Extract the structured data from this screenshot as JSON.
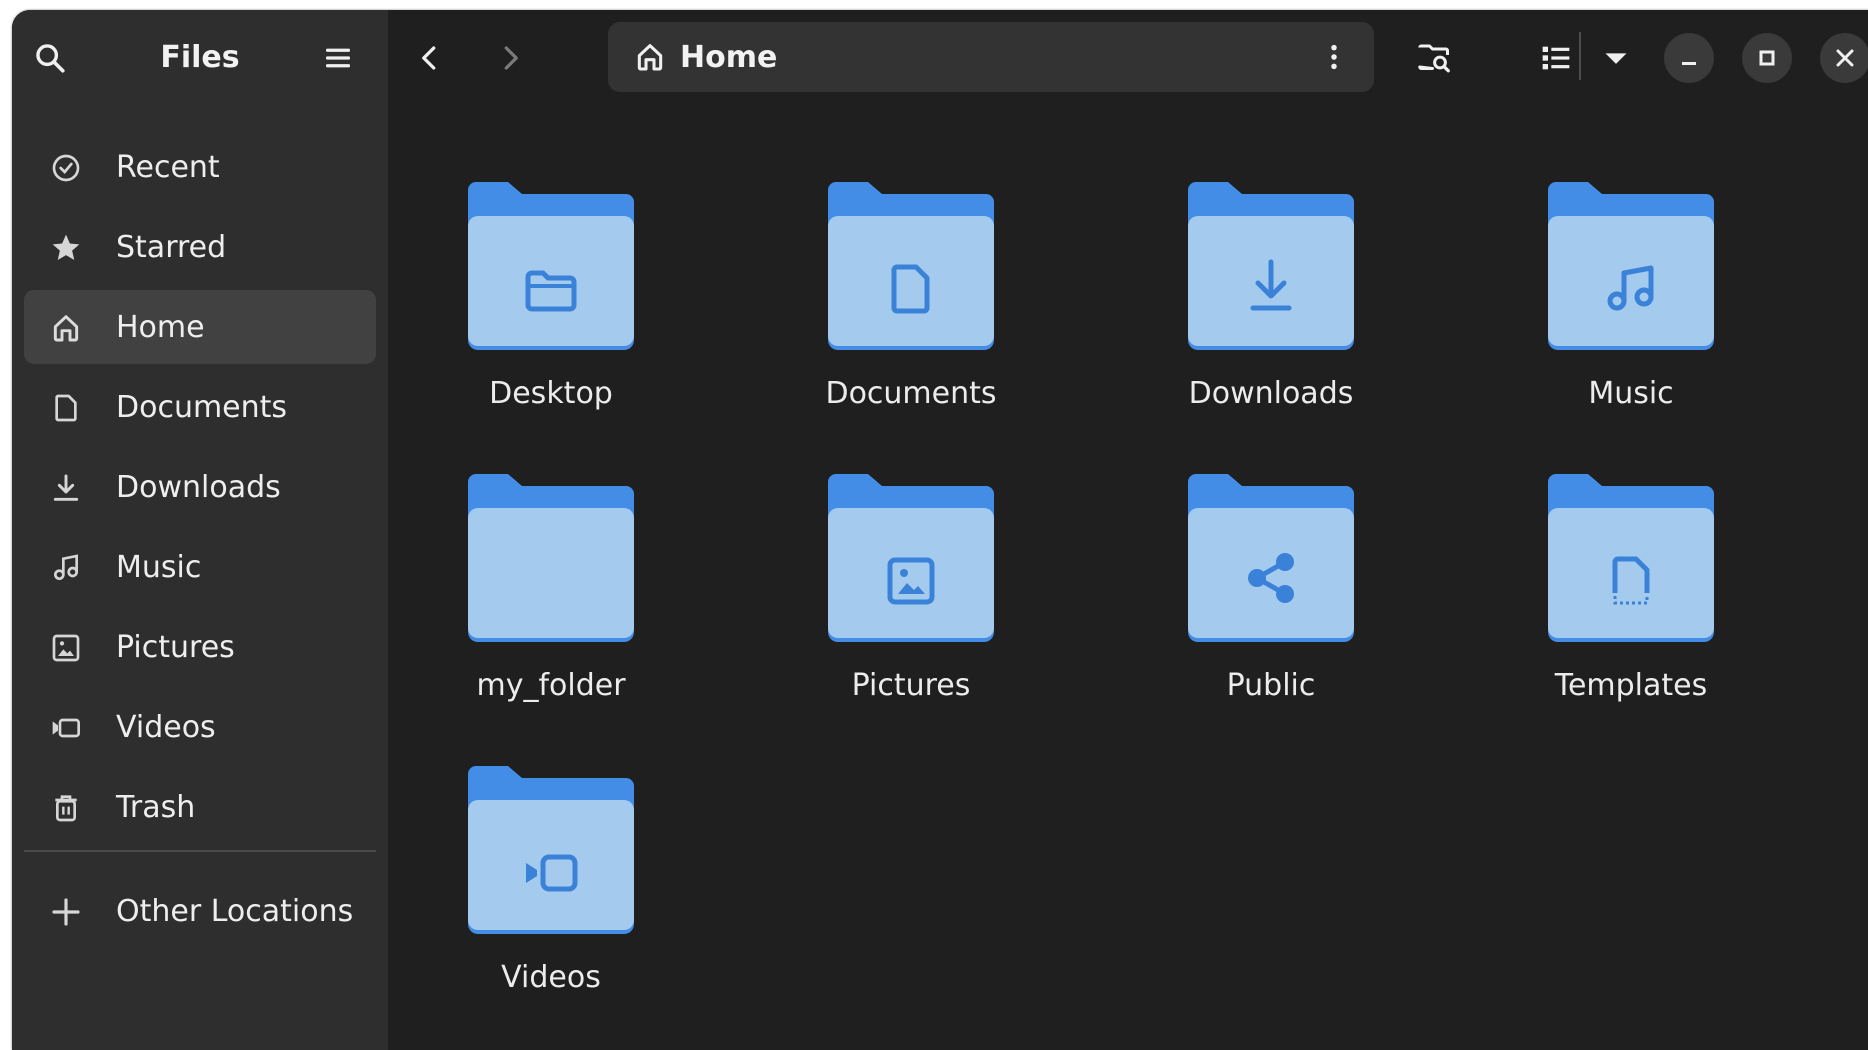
{
  "app": {
    "title": "Files"
  },
  "sidebar": {
    "items": [
      {
        "label": "Recent",
        "icon": "clock-icon",
        "active": false
      },
      {
        "label": "Starred",
        "icon": "star-icon",
        "active": false
      },
      {
        "label": "Home",
        "icon": "home-icon",
        "active": true
      },
      {
        "label": "Documents",
        "icon": "document-icon",
        "active": false
      },
      {
        "label": "Downloads",
        "icon": "download-icon",
        "active": false
      },
      {
        "label": "Music",
        "icon": "music-icon",
        "active": false
      },
      {
        "label": "Pictures",
        "icon": "picture-icon",
        "active": false
      },
      {
        "label": "Videos",
        "icon": "video-icon",
        "active": false
      },
      {
        "label": "Trash",
        "icon": "trash-icon",
        "active": false
      }
    ],
    "other_locations": {
      "label": "Other Locations",
      "icon": "plus-icon"
    }
  },
  "header": {
    "path": {
      "label": "Home",
      "icon": "home-icon"
    }
  },
  "folders": [
    {
      "name": "Desktop",
      "emblem": "folder-emblem-icon"
    },
    {
      "name": "Documents",
      "emblem": "document-emblem-icon"
    },
    {
      "name": "Downloads",
      "emblem": "download-emblem-icon"
    },
    {
      "name": "Music",
      "emblem": "music-emblem-icon"
    },
    {
      "name": "my_folder",
      "emblem": "none"
    },
    {
      "name": "Pictures",
      "emblem": "picture-emblem-icon"
    },
    {
      "name": "Public",
      "emblem": "share-emblem-icon"
    },
    {
      "name": "Templates",
      "emblem": "template-emblem-icon"
    },
    {
      "name": "Videos",
      "emblem": "video-emblem-icon"
    }
  ],
  "colors": {
    "window_bg": "#1f1f1f",
    "sidebar_bg": "#2e2e2e",
    "folder_back": "#438de6",
    "folder_front": "#a4caee",
    "emblem": "#3a81d8"
  }
}
